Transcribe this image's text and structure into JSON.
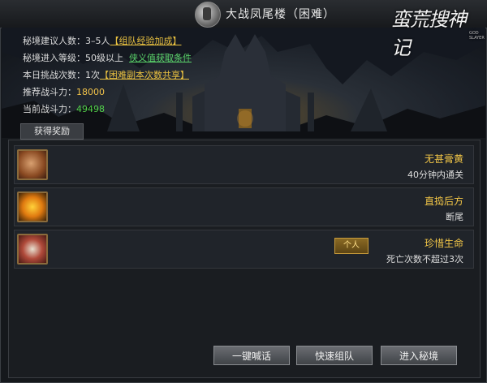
{
  "window": {
    "title": "大战凤尾楼（困难）"
  },
  "logo": {
    "text": "蛮荒搜神记",
    "subtext": "GOD SLAYER"
  },
  "info": {
    "recommended_players_label": "秘境建议人数：",
    "recommended_players_value": "3–5人",
    "team_bonus_link": "【组队经验加成】",
    "entry_level_label": "秘境进入等级：",
    "entry_level_value": "50级以上",
    "favor_link": "侠义值获取条件",
    "daily_challenges_label": "本日挑战次数：",
    "daily_challenges_value": "1次",
    "shared_link": "【困难副本次数共享】",
    "recommended_power_label": "推荐战斗力：",
    "recommended_power_value": "18000",
    "current_power_label": "当前战斗力：",
    "current_power_value": "49498"
  },
  "rewards_tab": {
    "label": "获得奖励"
  },
  "rewards": [
    {
      "name": "无甚膏黄",
      "desc": "40分钟内通关",
      "icon": "bun-icon",
      "tag": ""
    },
    {
      "name": "直捣后方",
      "desc": "断尾",
      "icon": "feather-icon",
      "tag": ""
    },
    {
      "name": "珍惜生命",
      "desc": "死亡次数不超过3次",
      "icon": "chest-icon",
      "tag": "个人"
    }
  ],
  "buttons": {
    "shout": "一键喊话",
    "quick_team": "快速组队",
    "enter": "进入秘境"
  },
  "colors": {
    "accent_gold": "#f2c647",
    "power_green": "#52d14a",
    "link_yellow": "#e8c040"
  }
}
